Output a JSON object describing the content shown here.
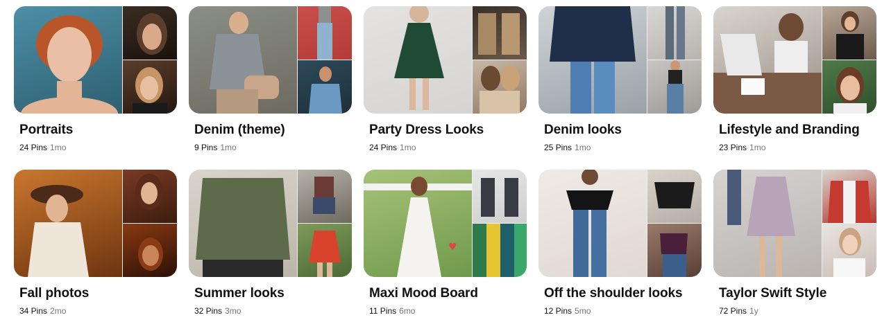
{
  "boards": [
    {
      "title": "Portraits",
      "pins": "24 Pins",
      "age": "1mo",
      "colors": {
        "main": [
          "#4d8fa6",
          "#2d5f70"
        ],
        "top": [
          "#3a2c22",
          "#1a120d"
        ],
        "bot": [
          "#5a3e2c",
          "#26170f"
        ]
      },
      "main_icon": "portrait-woman-image"
    },
    {
      "title": "Denim (theme)",
      "pins": "9 Pins",
      "age": "1mo",
      "colors": {
        "main": [
          "#8a8f87",
          "#6e6a5f"
        ],
        "top": [
          "#c9504a",
          "#b53c36"
        ],
        "bot": [
          "#2e4a5a",
          "#1d2f3a"
        ]
      },
      "main_icon": "denim-jacket-image"
    },
    {
      "title": "Party Dress Looks",
      "pins": "24 Pins",
      "age": "1mo",
      "colors": {
        "main": [
          "#e4e3e1",
          "#d6d4d2"
        ],
        "top": [
          "#3b2f28",
          "#6b5a4a"
        ],
        "bot": [
          "#c9b8a6",
          "#8f7a66"
        ]
      },
      "main_icon": "green-dress-image"
    },
    {
      "title": "Denim looks",
      "pins": "25 Pins",
      "age": "1mo",
      "colors": {
        "main": [
          "#cfd3d6",
          "#9aa2a8"
        ],
        "top": [
          "#d8d6d2",
          "#b8b4ae"
        ],
        "bot": [
          "#c7c5c1",
          "#9e9b96"
        ]
      },
      "main_icon": "navy-sweater-jeans-image"
    },
    {
      "title": "Lifestyle and Branding",
      "pins": "23 Pins",
      "age": "1mo",
      "colors": {
        "main": [
          "#d8d4cf",
          "#9a8f85"
        ],
        "top": [
          "#b8a89a",
          "#6e5b4b"
        ],
        "bot": [
          "#4f7a4a",
          "#2f4f2c"
        ]
      },
      "main_icon": "laptop-desk-image"
    },
    {
      "title": "Fall photos",
      "pins": "34 Pins",
      "age": "2mo",
      "colors": {
        "main": [
          "#c9772e",
          "#6e3410"
        ],
        "top": [
          "#7a3a22",
          "#3d1c10"
        ],
        "bot": [
          "#8a3a12",
          "#2a1006"
        ]
      },
      "main_icon": "autumn-portrait-image"
    },
    {
      "title": "Summer looks",
      "pins": "32 Pins",
      "age": "3mo",
      "colors": {
        "main": [
          "#d9d4cc",
          "#bdb5aa"
        ],
        "top": [
          "#b7b2a9",
          "#6f6a60"
        ],
        "bot": [
          "#7f9a5a",
          "#4a6a35"
        ]
      },
      "main_icon": "olive-tshirt-image"
    },
    {
      "title": "Maxi Mood Board",
      "pins": "11 Pins",
      "age": "6mo",
      "colors": {
        "main": [
          "#a7c27a",
          "#6f9a4a"
        ],
        "top": [
          "#e6e6e6",
          "#cfcfcf"
        ],
        "bot": [
          "#2f8f5a",
          "#e7c532"
        ]
      },
      "main_icon": "white-maxi-dress-image"
    },
    {
      "title": "Off the shoulder looks",
      "pins": "12 Pins",
      "age": "5mo",
      "colors": {
        "main": [
          "#efeae5",
          "#e0d9d2"
        ],
        "top": [
          "#d9d3cc",
          "#b5aea6"
        ],
        "bot": [
          "#9a7b6b",
          "#5a3f36"
        ]
      },
      "main_icon": "off-shoulder-top-image"
    },
    {
      "title": "Taylor Swift Style",
      "pins": "72 Pins",
      "age": "1y",
      "colors": {
        "main": [
          "#d6d3d1",
          "#b9b4b0"
        ],
        "top": [
          "#d8d4cf",
          "#b5382e"
        ],
        "bot": [
          "#e9e4e0",
          "#c9bdb6"
        ]
      },
      "main_icon": "lilac-dress-image"
    }
  ]
}
